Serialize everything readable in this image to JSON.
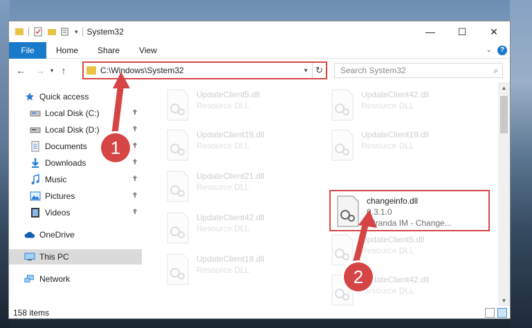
{
  "window": {
    "title": "System32",
    "controls": {
      "minimize": "—",
      "maximize": "☐",
      "close": "✕"
    }
  },
  "ribbon": {
    "tabs": [
      "File",
      "Home",
      "Share",
      "View"
    ],
    "collapse_icon": "chevron-down-icon",
    "help": "?"
  },
  "navigation": {
    "back": "←",
    "forward": "→",
    "dropdown": "▾",
    "up": "↑",
    "address": "C:\\Windows\\System32",
    "address_dropdown": "▾",
    "refresh": "↻",
    "search_placeholder": "Search System32",
    "search_icon": "⌕"
  },
  "sidebar": {
    "items": [
      {
        "label": "Quick access",
        "icon": "star-icon",
        "pinned": false
      },
      {
        "label": "Local Disk (C:)",
        "icon": "drive-icon",
        "pinned": true
      },
      {
        "label": "Local Disk (D:)",
        "icon": "drive-icon",
        "pinned": true
      },
      {
        "label": "Documents",
        "icon": "documents-icon",
        "pinned": true
      },
      {
        "label": "Downloads",
        "icon": "download-icon",
        "pinned": true
      },
      {
        "label": "Music",
        "icon": "music-icon",
        "pinned": true
      },
      {
        "label": "Pictures",
        "icon": "pictures-icon",
        "pinned": true
      },
      {
        "label": "Videos",
        "icon": "videos-icon",
        "pinned": true
      },
      {
        "label": "OneDrive",
        "icon": "cloud-icon",
        "pinned": false
      },
      {
        "label": "This PC",
        "icon": "computer-icon",
        "pinned": false,
        "selected": true
      },
      {
        "label": "Network",
        "icon": "network-icon",
        "pinned": false
      }
    ],
    "pin_glyph": "📌"
  },
  "files": [
    {
      "name": "UpdateClient5.dll",
      "desc": "Resource DLL",
      "faded": true
    },
    {
      "name": "UpdateClient42.dll",
      "desc": "Resource DLL",
      "faded": true
    },
    {
      "name": "UpdateClient19.dll",
      "desc": "Resource DLL",
      "faded": true
    },
    {
      "name": "UpdateClient19.dll",
      "desc": "Resource DLL",
      "faded": true
    },
    {
      "name": "UpdateClient21.dll",
      "desc": "Resource DLL",
      "faded": true
    },
    {
      "name": "changeinfo.dll",
      "version": "0.3.1.0",
      "desc": "Miranda IM - Change...",
      "faded": false,
      "highlighted": true
    },
    {
      "name": "UpdateClient42.dll",
      "desc": "Resource DLL",
      "faded": true
    },
    {
      "name": "UpdateClient5.dll",
      "desc": "Resource DLL",
      "faded": true
    },
    {
      "name": "UpdateClient19.dll",
      "desc": "Resource DLL",
      "faded": true
    },
    {
      "name": "UpdateClient42.dll",
      "desc": "Resource DLL",
      "faded": true
    }
  ],
  "status": {
    "item_count": "158 items"
  },
  "callouts": [
    {
      "label": "1",
      "color": "#d64545"
    },
    {
      "label": "2",
      "color": "#d64545"
    }
  ],
  "colors": {
    "accent": "#1979ca",
    "highlight": "#d64545",
    "folder": "#e9c246"
  }
}
